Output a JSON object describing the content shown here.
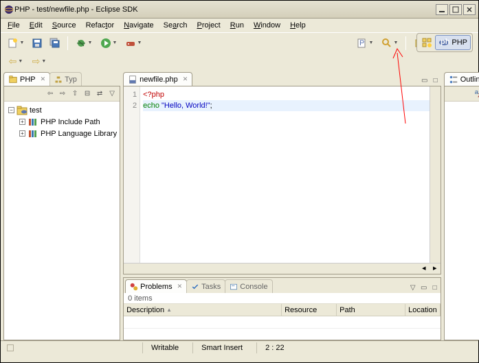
{
  "window": {
    "title": "PHP - test/newfile.php - Eclipse SDK"
  },
  "menu": {
    "file": "File",
    "edit": "Edit",
    "source": "Source",
    "refactor": "Refactor",
    "navigate": "Navigate",
    "search": "Search",
    "project": "Project",
    "run": "Run",
    "window": "Window",
    "help": "Help"
  },
  "perspective": {
    "label": "PHP"
  },
  "php_view": {
    "tab": "PHP",
    "type_tab": "Typ",
    "project": "test",
    "include_path": "PHP Include Path",
    "lang_library": "PHP Language Library"
  },
  "editor": {
    "tab": "newfile.php",
    "lines": {
      "l1": "1",
      "l2": "2"
    },
    "code": {
      "l1": "<?php",
      "l2a": "echo ",
      "l2b": "\"Hello, World!\"",
      "l2c": ";"
    }
  },
  "outline": {
    "title": "Outline"
  },
  "problems": {
    "tab": "Problems",
    "tasks": "Tasks",
    "console": "Console",
    "count": "0 items",
    "col_desc": "Description",
    "col_resource": "Resource",
    "col_path": "Path",
    "col_location": "Location"
  },
  "status": {
    "writable": "Writable",
    "insert": "Smart Insert",
    "pos": "2 : 22"
  }
}
